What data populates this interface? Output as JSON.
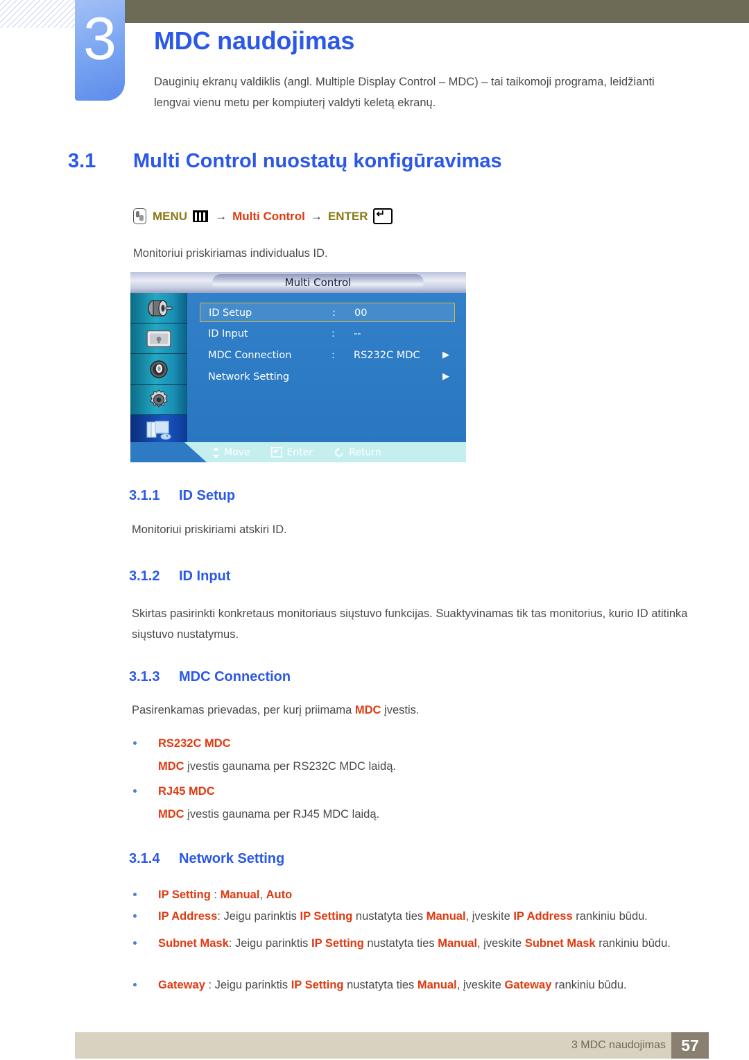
{
  "colors": {
    "heading_blue": "#2b58e8",
    "highlight_red": "#e03a10",
    "olive": "#6d6a55",
    "menu_olive_text": "#8a7a17",
    "footer_bar": "#d8d2c0",
    "page_box": "#8a8071",
    "osd_blue": "#2e7bc4",
    "osd_select_border": "#d8b53c"
  },
  "chapter": {
    "number": "3",
    "title": "MDC naudojimas",
    "intro": "Dauginių ekranų valdiklis (angl. Multiple Display Control – MDC) – tai taikomoji programa, leidžianti lengvai vienu metu per kompiuterį valdyti keletą ekranų."
  },
  "section": {
    "number": "3.1",
    "title": "Multi Control nuostatų konfigūravimas"
  },
  "menu_path": {
    "remote_icon": "remote-hand-icon",
    "menu_label": "MENU",
    "menu_icon": "menu-grid-icon",
    "arrow1": "→",
    "target": "Multi Control",
    "arrow2": "→",
    "enter_label": "ENTER",
    "enter_icon": "enter-key-icon"
  },
  "intro_line": "Monitoriui priskiriamas individualus ID.",
  "osd": {
    "title": "Multi Control",
    "sidebar": [
      {
        "name": "picture-roller-icon"
      },
      {
        "name": "screen-adjust-icon"
      },
      {
        "name": "sound-speaker-icon"
      },
      {
        "name": "setup-gear-icon"
      },
      {
        "name": "multi-control-icon"
      }
    ],
    "rows": [
      {
        "label": "ID Setup",
        "colon": ":",
        "value": "00",
        "arrow": "",
        "selected": true
      },
      {
        "label": "ID Input",
        "colon": ":",
        "value": "--",
        "arrow": "",
        "selected": false
      },
      {
        "label": "MDC Connection",
        "colon": ":",
        "value": "RS232C MDC",
        "arrow": "▶",
        "selected": false
      },
      {
        "label": "Network Setting",
        "colon": "",
        "value": "",
        "arrow": "▶",
        "selected": false
      }
    ],
    "footer": [
      {
        "icon": "up-down-arrow-icon",
        "label": "Move"
      },
      {
        "icon": "enter-icon",
        "label": "Enter"
      },
      {
        "icon": "return-icon",
        "label": "Return"
      }
    ]
  },
  "sub_sections": {
    "id_setup": {
      "number": "3.1.1",
      "title": "ID Setup",
      "body": "Monitoriui priskiriami atskiri ID."
    },
    "id_input": {
      "number": "3.1.2",
      "title": "ID Input",
      "body": "Skirtas pasirinkti konkretaus monitoriaus siųstuvo funkcijas. Suaktyvinamas tik tas monitorius, kurio ID atitinka siųstuvo nustatymus."
    },
    "mdc_connection": {
      "number": "3.1.3",
      "title": "MDC Connection",
      "intro_a": "Pasirenkamas prievadas, per kurį priimama ",
      "intro_hl": "MDC",
      "intro_b": " įvestis.",
      "items": [
        {
          "label": "RS232C MDC",
          "desc_hl": "MDC",
          "desc_text": " įvestis gaunama per RS232C MDC laidą."
        },
        {
          "label": "RJ45 MDC",
          "desc_hl": "MDC",
          "desc_text": " įvestis gaunama per RJ45 MDC laidą."
        }
      ]
    },
    "network_setting": {
      "number": "3.1.4",
      "title": "Network Setting",
      "bullets": [
        {
          "name": "ip-setting",
          "parts": [
            {
              "t": "IP Setting",
              "hl": true
            },
            {
              "t": " : ",
              "hl": false
            },
            {
              "t": "Manual",
              "hl": true
            },
            {
              "t": ", ",
              "hl": false
            },
            {
              "t": "Auto",
              "hl": true
            }
          ]
        },
        {
          "name": "ip-address",
          "parts": [
            {
              "t": "IP Address",
              "hl": true
            },
            {
              "t": ": Jeigu parinktis ",
              "hl": false
            },
            {
              "t": "IP Setting",
              "hl": true
            },
            {
              "t": " nustatyta ties ",
              "hl": false
            },
            {
              "t": "Manual",
              "hl": true
            },
            {
              "t": ", įveskite ",
              "hl": false
            },
            {
              "t": "IP Address",
              "hl": true
            },
            {
              "t": " rankiniu būdu.",
              "hl": false
            }
          ]
        },
        {
          "name": "subnet-mask",
          "parts": [
            {
              "t": "Subnet Mask",
              "hl": true
            },
            {
              "t": ": Jeigu parinktis ",
              "hl": false
            },
            {
              "t": "IP Setting",
              "hl": true
            },
            {
              "t": " nustatyta ties ",
              "hl": false
            },
            {
              "t": "Manual",
              "hl": true
            },
            {
              "t": ", įveskite ",
              "hl": false
            },
            {
              "t": "Subnet Mask",
              "hl": true
            },
            {
              "t": " rankiniu būdu.",
              "hl": false
            }
          ]
        },
        {
          "name": "gateway",
          "parts": [
            {
              "t": "Gateway",
              "hl": true
            },
            {
              "t": " : Jeigu parinktis ",
              "hl": false
            },
            {
              "t": "IP Setting",
              "hl": true
            },
            {
              "t": " nustatyta ties ",
              "hl": false
            },
            {
              "t": "Manual",
              "hl": true
            },
            {
              "t": ", įveskite ",
              "hl": false
            },
            {
              "t": "Gateway",
              "hl": true
            },
            {
              "t": " rankiniu būdu.",
              "hl": false
            }
          ]
        }
      ]
    }
  },
  "footer": {
    "text": "3 MDC naudojimas",
    "page": "57"
  }
}
